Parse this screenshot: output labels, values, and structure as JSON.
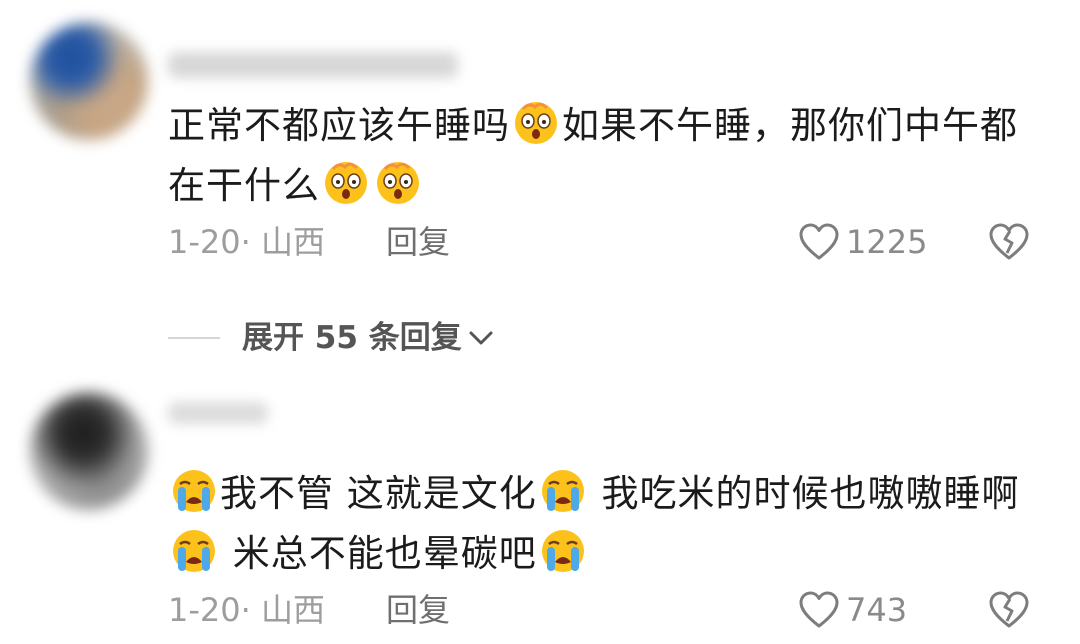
{
  "comments": [
    {
      "text_part1": "正常不都应该午睡吗",
      "text_part2": "如果不午睡，那你们中午都在干什么",
      "date_location": "1-20· 山西",
      "reply_label": "回复",
      "like_count": "1225",
      "emoji_name": "astonished-face-emoji"
    },
    {
      "text_part1": "我不管 这就是文化",
      "text_part2": " 我吃米的时候也嗷嗷睡啊",
      "text_part3": " 米总不能也晕碳吧",
      "date_location": "1-20· 山西",
      "reply_label": "回复",
      "like_count": "743",
      "emoji_name": "loudly-crying-face-emoji"
    }
  ],
  "expand_replies": {
    "label": "展开 55 条回复"
  },
  "colors": {
    "body_text": "#1b1b1b",
    "meta_text": "#9d9d9d",
    "emoji_yellow": "#fcc21b",
    "tear_blue": "#4fa8e8"
  }
}
